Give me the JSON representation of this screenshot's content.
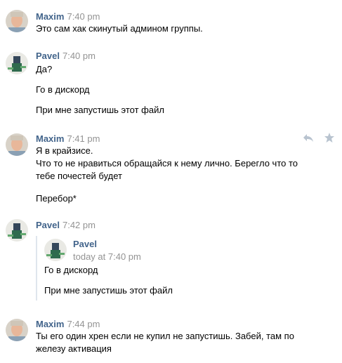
{
  "messages": [
    {
      "author": "Maxim",
      "time": "7:40 pm",
      "lines": [
        "Это сам хак скинутый админом группы."
      ]
    },
    {
      "author": "Pavel",
      "time": "7:40 pm",
      "lines": [
        "Да?",
        "Го в дискорд",
        "При мне запустишь этот файл"
      ]
    },
    {
      "author": "Maxim",
      "time": "7:41 pm",
      "lines": [
        "Я в крайзисе.",
        "Что то не нравиться обращайся к нему лично. Берегло что то",
        "тебе почестей будет",
        "Перебор*"
      ]
    },
    {
      "author": "Pavel",
      "time": "7:42 pm",
      "quote": {
        "author": "Pavel",
        "time": "today at 7:40 pm",
        "lines": [
          "Го в дискорд",
          "При мне запустишь этот файл"
        ]
      }
    },
    {
      "author": "Maxim",
      "time": "7:44 pm",
      "lines": [
        "Ты его один хрен если не купил не запустишь. Забей, там по",
        "железу активация"
      ]
    }
  ],
  "icons": {
    "reply": "reply-arrow-icon",
    "star": "star-icon"
  },
  "colors": {
    "author": "#42648b",
    "time": "#939393",
    "quote_bar": "#dfe6ed",
    "action_icon": "#b8c3cf"
  }
}
